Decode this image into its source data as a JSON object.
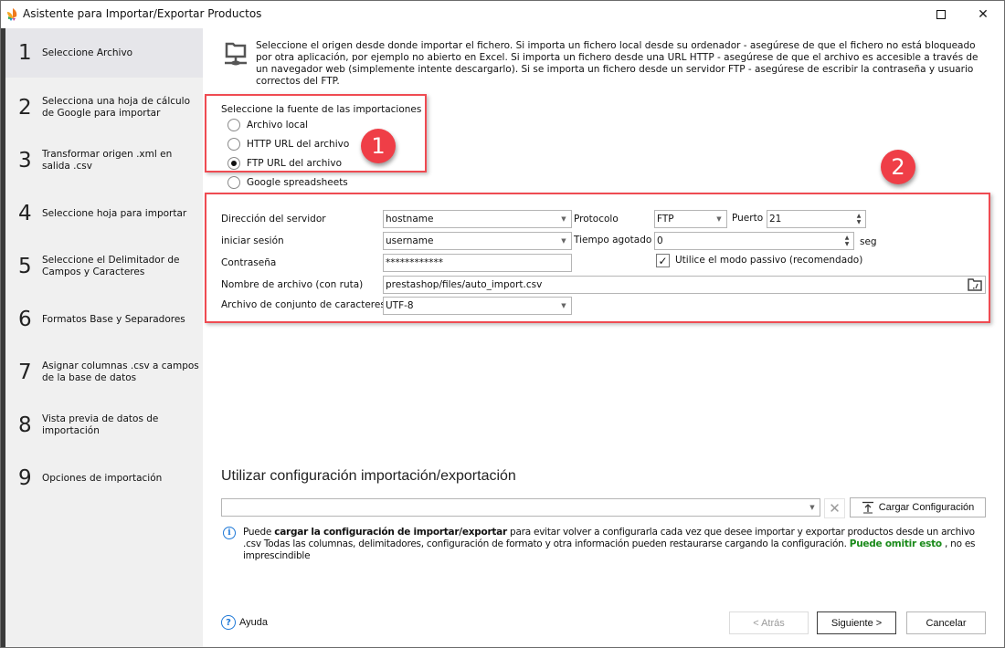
{
  "window": {
    "title": "Asistente para Importar/Exportar Productos",
    "maximize_glyph": "",
    "close_glyph": "✕"
  },
  "sidebar": {
    "active_index": 0,
    "steps": [
      {
        "num": "1",
        "label": "Seleccione Archivo"
      },
      {
        "num": "2",
        "label": "Selecciona una hoja de cálculo de Google para importar"
      },
      {
        "num": "3",
        "label": "Transformar origen .xml en salida .csv"
      },
      {
        "num": "4",
        "label": "Seleccione hoja para importar"
      },
      {
        "num": "5",
        "label": "Seleccione el Delimitador de Campos y Caracteres"
      },
      {
        "num": "6",
        "label": "Formatos Base y Separadores"
      },
      {
        "num": "7",
        "label": "Asignar columnas .csv a campos de la base de datos"
      },
      {
        "num": "8",
        "label": "Vista previa de datos de importación"
      },
      {
        "num": "9",
        "label": "Opciones de importación"
      }
    ]
  },
  "intro": {
    "icon": "network-folder-icon",
    "text": "Seleccione el origen desde donde importar el fichero. Si importa un fichero local desde su ordenador - asegúrese de que el fichero no está bloqueado por otra aplicación, por ejemplo no abierto en Excel. Si importa un fichero desde una URL HTTP - asegúrese de que el archivo es accesible a través de un navegador web (simplemente intente descargarlo). Si se importa un fichero desde un servidor FTP - asegúrese de escribir la contraseña y usuario correctos del FTP."
  },
  "source": {
    "label": "Seleccione la fuente de las importaciones",
    "options": [
      {
        "label": "Archivo local",
        "checked": false
      },
      {
        "label": "HTTP URL del archivo",
        "checked": false
      },
      {
        "label": "FTP URL del archivo",
        "checked": true
      },
      {
        "label": "Google spreadsheets",
        "checked": false
      }
    ]
  },
  "annotations": {
    "badge1": "1",
    "badge2": "2",
    "color": "#ef3e47"
  },
  "ftp": {
    "server_label": "Dirección del servidor",
    "server_value": "hostname",
    "login_label": "iniciar sesión",
    "login_value": "username",
    "password_label": "Contraseña",
    "password_value": "************",
    "filename_label": "Nombre de archivo (con ruta)",
    "filename_value": "prestashop/files/auto_import.csv",
    "charset_label": "Archivo de conjunto de caracteres",
    "charset_value": "UTF-8",
    "protocol_label": "Protocolo",
    "protocol_value": "FTP",
    "port_label": "Puerto",
    "port_value": "21",
    "timeout_label": "Tiempo agotado",
    "timeout_value": "0",
    "timeout_unit": "seg",
    "passive_label": "Utilice el modo passivo (recomendado)",
    "passive_checked": true
  },
  "config": {
    "title": "Utilizar configuración importación/exportación",
    "select_value": "",
    "clear_glyph": "✕",
    "load_button": "Cargar Configuración",
    "info_pre": "Puede ",
    "info_bold": "cargar la configuración de importar/exportar",
    "info_mid": " para evitar volver a configurarla cada vez que desee importar y exportar productos desde un archivo .csv Todas las columnas, delimitadores, configuración de formato y otra información pueden restaurarse cargando la configuración. ",
    "info_green": "Puede omitir esto",
    "info_post": " , no es imprescindible",
    "accent_green": "#1a8a1a"
  },
  "footer": {
    "help_label": "Ayuda",
    "back_button": "< Atrás",
    "next_button": "Siguiente >",
    "cancel_button": "Cancelar"
  }
}
